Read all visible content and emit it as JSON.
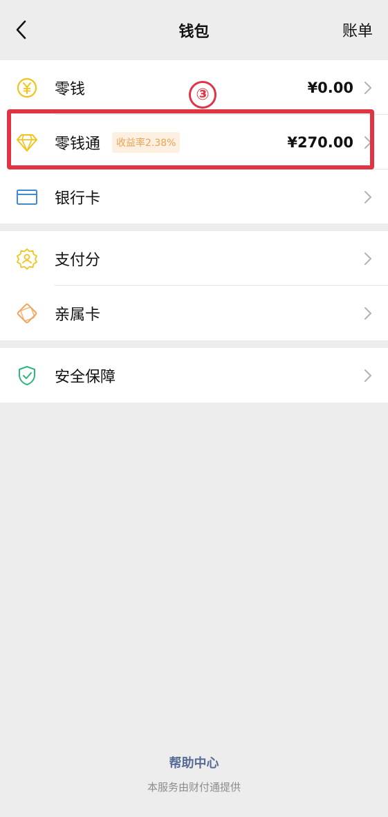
{
  "header": {
    "title": "钱包",
    "bill_label": "账单"
  },
  "group1": {
    "items": [
      {
        "label": "零钱",
        "value": "¥0.00",
        "icon": "yuan-coin-icon"
      },
      {
        "label": "零钱通",
        "badge": "收益率2.38%",
        "value": "¥270.00",
        "icon": "diamond-icon"
      },
      {
        "label": "银行卡",
        "icon": "bank-card-icon"
      }
    ]
  },
  "group2": {
    "items": [
      {
        "label": "支付分",
        "icon": "pay-score-icon"
      },
      {
        "label": "亲属卡",
        "icon": "family-card-icon"
      }
    ]
  },
  "group3": {
    "items": [
      {
        "label": "安全保障",
        "icon": "shield-check-icon"
      }
    ]
  },
  "annotation": {
    "step_marker": "③"
  },
  "footer": {
    "help_center": "帮助中心",
    "provider": "本服务由财付通提供"
  },
  "colors": {
    "background": "#ededed",
    "highlight": "#e03445",
    "link": "#576b95",
    "badge_text": "#e6a456",
    "badge_bg": "#fdf0e0",
    "yellow_icon": "#f0c419",
    "blue_icon": "#3d8ad1",
    "orange_icon": "#f0a45c",
    "green_icon": "#2cb67d"
  }
}
